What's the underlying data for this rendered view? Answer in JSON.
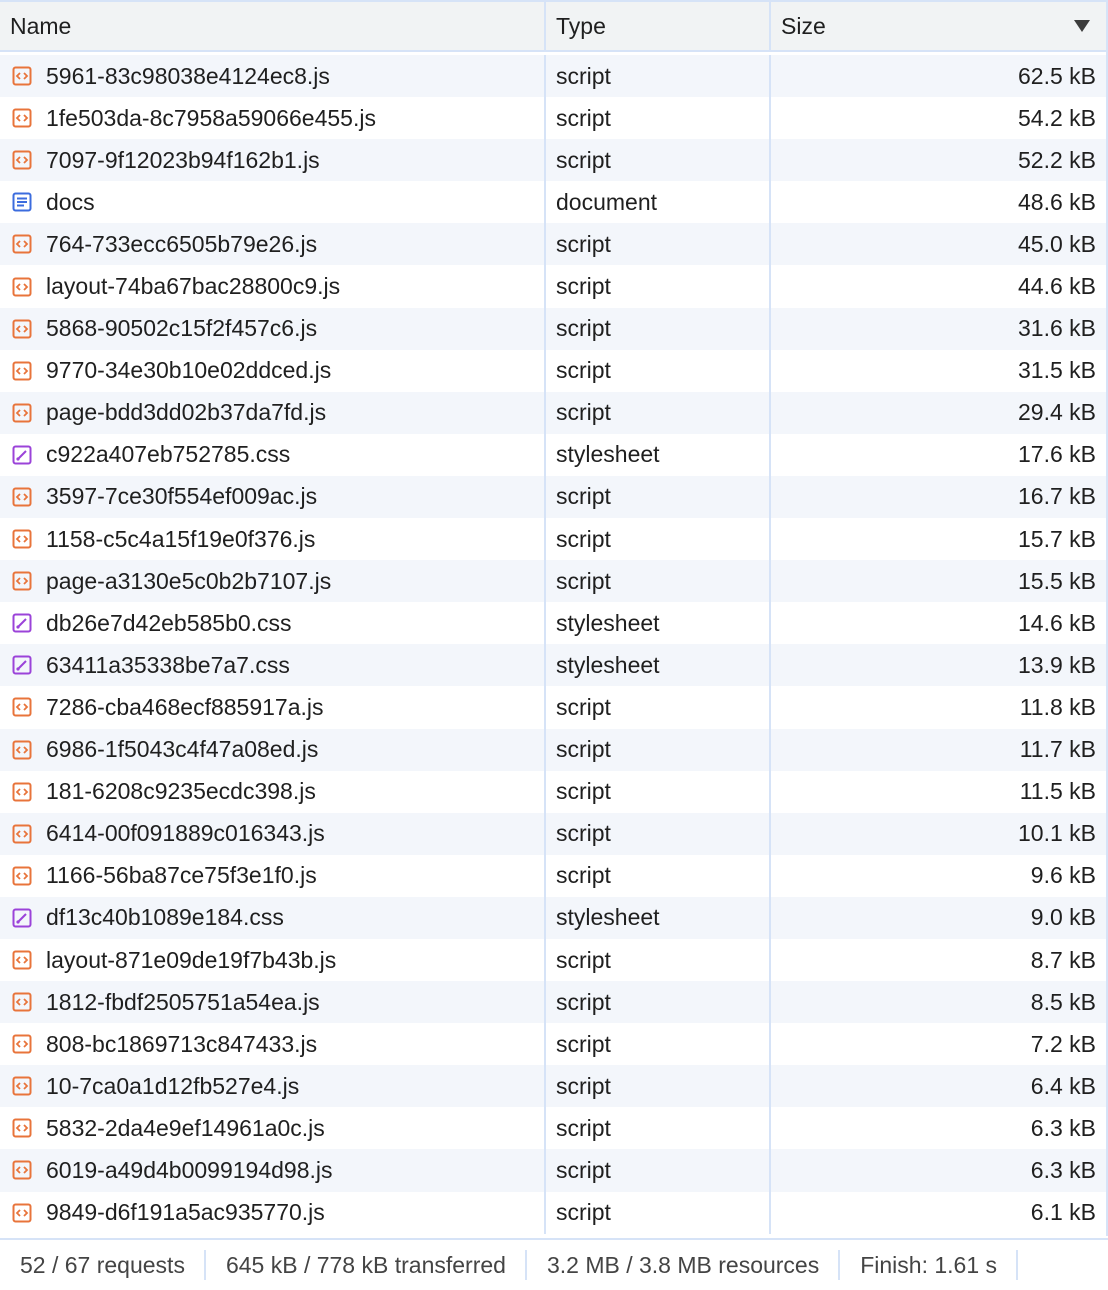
{
  "header": {
    "name_label": "Name",
    "type_label": "Type",
    "size_label": "Size",
    "sort_direction": "descending"
  },
  "icon_colors": {
    "script": "#e8743b",
    "document": "#3c6cde",
    "stylesheet": "#9b43d9"
  },
  "rows": [
    {
      "name": "5961-83c98038e4124ec8.js",
      "type": "script",
      "size": "62.5 kB",
      "icon": "script-icon"
    },
    {
      "name": "1fe503da-8c7958a59066e455.js",
      "type": "script",
      "size": "54.2 kB",
      "icon": "script-icon"
    },
    {
      "name": "7097-9f12023b94f162b1.js",
      "type": "script",
      "size": "52.2 kB",
      "icon": "script-icon"
    },
    {
      "name": "docs",
      "type": "document",
      "size": "48.6 kB",
      "icon": "document-icon"
    },
    {
      "name": "764-733ecc6505b79e26.js",
      "type": "script",
      "size": "45.0 kB",
      "icon": "script-icon"
    },
    {
      "name": "layout-74ba67bac28800c9.js",
      "type": "script",
      "size": "44.6 kB",
      "icon": "script-icon"
    },
    {
      "name": "5868-90502c15f2f457c6.js",
      "type": "script",
      "size": "31.6 kB",
      "icon": "script-icon"
    },
    {
      "name": "9770-34e30b10e02ddced.js",
      "type": "script",
      "size": "31.5 kB",
      "icon": "script-icon"
    },
    {
      "name": "page-bdd3dd02b37da7fd.js",
      "type": "script",
      "size": "29.4 kB",
      "icon": "script-icon"
    },
    {
      "name": "c922a407eb752785.css",
      "type": "stylesheet",
      "size": "17.6 kB",
      "icon": "stylesheet-icon"
    },
    {
      "name": "3597-7ce30f554ef009ac.js",
      "type": "script",
      "size": "16.7 kB",
      "icon": "script-icon"
    },
    {
      "name": "1158-c5c4a15f19e0f376.js",
      "type": "script",
      "size": "15.7 kB",
      "icon": "script-icon"
    },
    {
      "name": "page-a3130e5c0b2b7107.js",
      "type": "script",
      "size": "15.5 kB",
      "icon": "script-icon"
    },
    {
      "name": "db26e7d42eb585b0.css",
      "type": "stylesheet",
      "size": "14.6 kB",
      "icon": "stylesheet-icon"
    },
    {
      "name": "63411a35338be7a7.css",
      "type": "stylesheet",
      "size": "13.9 kB",
      "icon": "stylesheet-icon"
    },
    {
      "name": "7286-cba468ecf885917a.js",
      "type": "script",
      "size": "11.8 kB",
      "icon": "script-icon"
    },
    {
      "name": "6986-1f5043c4f47a08ed.js",
      "type": "script",
      "size": "11.7 kB",
      "icon": "script-icon"
    },
    {
      "name": "181-6208c9235ecdc398.js",
      "type": "script",
      "size": "11.5 kB",
      "icon": "script-icon"
    },
    {
      "name": "6414-00f091889c016343.js",
      "type": "script",
      "size": "10.1 kB",
      "icon": "script-icon"
    },
    {
      "name": "1166-56ba87ce75f3e1f0.js",
      "type": "script",
      "size": "9.6 kB",
      "icon": "script-icon"
    },
    {
      "name": "df13c40b1089e184.css",
      "type": "stylesheet",
      "size": "9.0 kB",
      "icon": "stylesheet-icon"
    },
    {
      "name": "layout-871e09de19f7b43b.js",
      "type": "script",
      "size": "8.7 kB",
      "icon": "script-icon"
    },
    {
      "name": "1812-fbdf2505751a54ea.js",
      "type": "script",
      "size": "8.5 kB",
      "icon": "script-icon"
    },
    {
      "name": "808-bc1869713c847433.js",
      "type": "script",
      "size": "7.2 kB",
      "icon": "script-icon"
    },
    {
      "name": "10-7ca0a1d12fb527e4.js",
      "type": "script",
      "size": "6.4 kB",
      "icon": "script-icon"
    },
    {
      "name": "5832-2da4e9ef14961a0c.js",
      "type": "script",
      "size": "6.3 kB",
      "icon": "script-icon"
    },
    {
      "name": "6019-a49d4b0099194d98.js",
      "type": "script",
      "size": "6.3 kB",
      "icon": "script-icon"
    },
    {
      "name": "9849-d6f191a5ac935770.js",
      "type": "script",
      "size": "6.1 kB",
      "icon": "script-icon"
    }
  ],
  "footer": {
    "requests": "52 / 67 requests",
    "transferred": "645 kB / 778 kB transferred",
    "resources": "3.2 MB / 3.8 MB resources",
    "finish": "Finish: 1.61 s"
  }
}
